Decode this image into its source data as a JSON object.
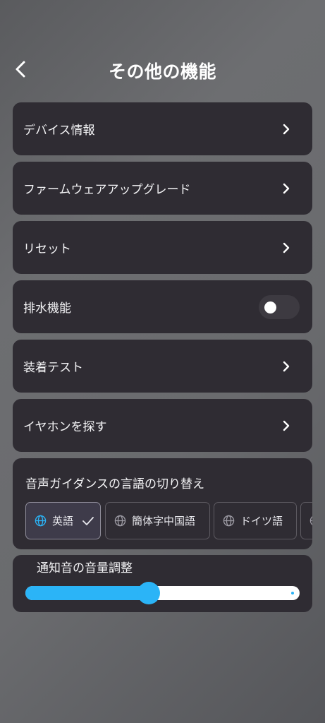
{
  "header": {
    "title": "その他の機能"
  },
  "menu": {
    "device_info": "デバイス情報",
    "firmware_upgrade": "ファームウェアアップグレード",
    "reset": "リセット",
    "drain": {
      "label": "排水機能",
      "enabled": false
    },
    "fit_test": "装着テスト",
    "find_earphones": "イヤホンを探す"
  },
  "voice_guidance": {
    "title": "音声ガイダンスの言語の切り替え",
    "languages": [
      {
        "label": "英語",
        "selected": true
      },
      {
        "label": "簡体字中国語",
        "selected": false
      },
      {
        "label": "ドイツ語",
        "selected": false
      }
    ]
  },
  "notification_volume": {
    "title": "通知音の音量調整",
    "level": 0.45
  },
  "colors": {
    "accent": "#2bb4f7",
    "card": "#2f2c33"
  },
  "icons": {
    "back": "chevron-left-icon",
    "row_arrow": "chevron-right-icon",
    "language": "globe-icon",
    "selected": "check-icon"
  }
}
